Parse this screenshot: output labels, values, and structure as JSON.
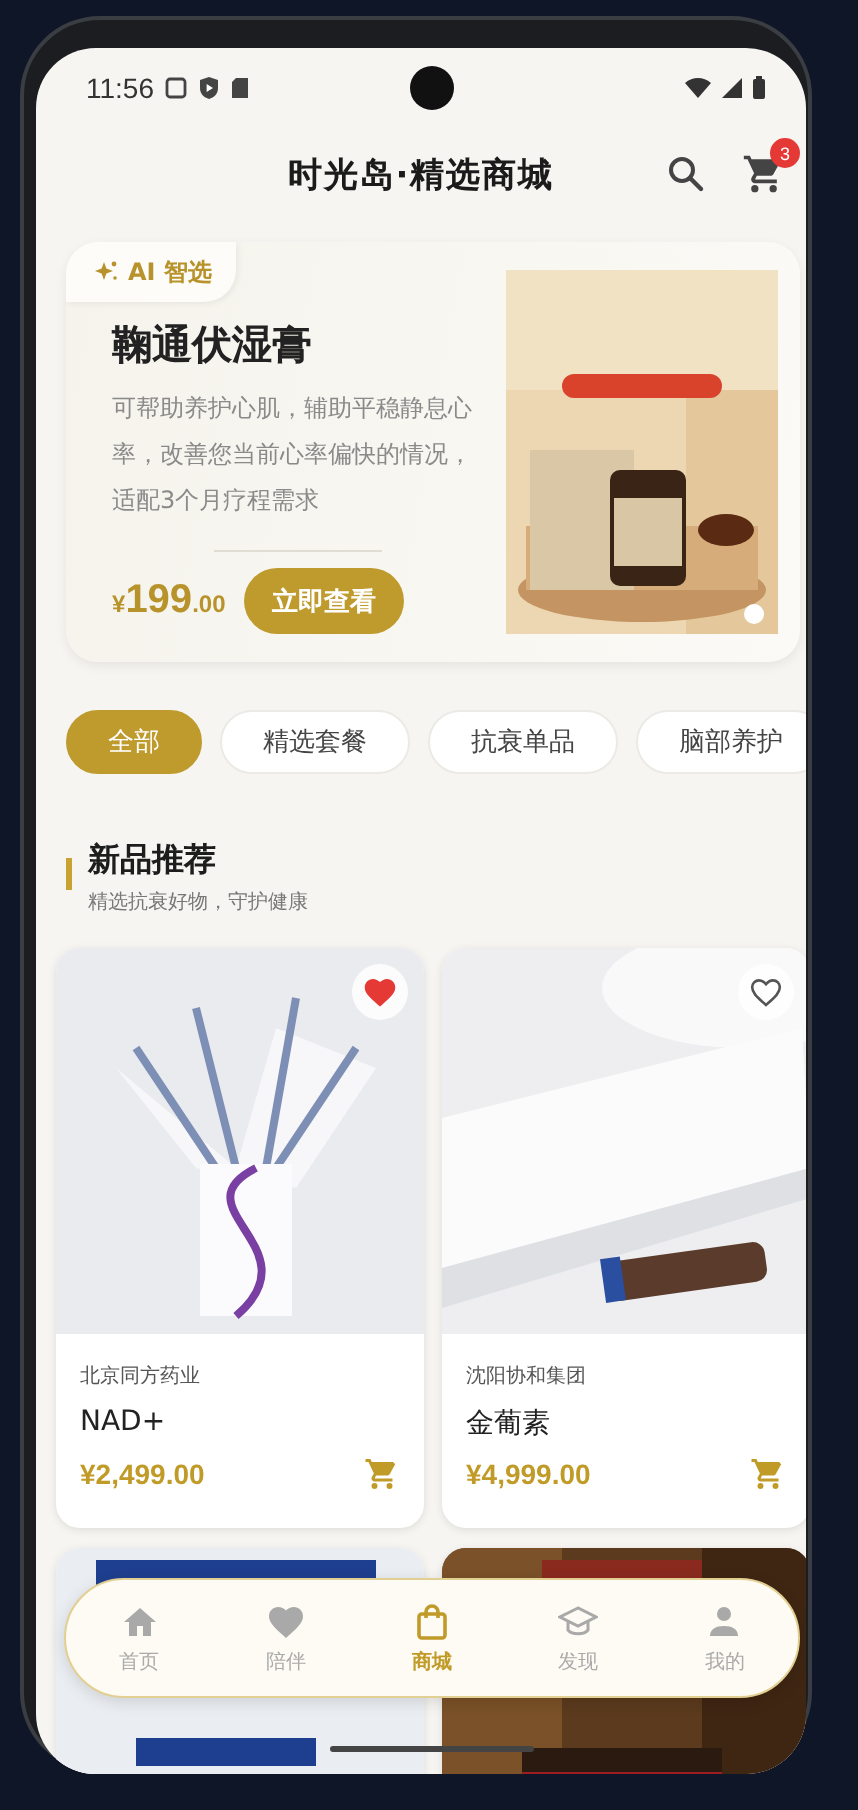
{
  "status_bar": {
    "time": "11:56"
  },
  "header": {
    "title": "时光岛·精选商城",
    "cart_count": "3"
  },
  "banner": {
    "tag": "AI 智选",
    "title": "鞠通伏湿膏",
    "description": "可帮助养护心肌，辅助平稳静息心率，改善您当前心率偏快的情况，适配3个月疗程需求",
    "price": {
      "currency": "¥",
      "amount": "199",
      "decimals": ".00"
    },
    "button": "立即查看",
    "image": {
      "kind": "picture"
    }
  },
  "categories": [
    {
      "label": "全部",
      "selected": true
    },
    {
      "label": "精选套餐",
      "selected": false
    },
    {
      "label": "抗衰单品",
      "selected": false
    },
    {
      "label": "脑部养护",
      "selected": false
    }
  ],
  "section": {
    "title": "新品推荐",
    "subtitle": "精选抗衰好物，守护健康"
  },
  "products": [
    {
      "kind": "full",
      "favorite": true,
      "brand": "北京同方药业",
      "name": "NAD+",
      "price": "¥2,499.00"
    },
    {
      "kind": "full",
      "favorite": false,
      "brand": "沈阳协和集团",
      "name": "金葡素",
      "price": "¥4,999.00"
    },
    {
      "kind": "picture"
    },
    {
      "kind": "picture"
    }
  ],
  "bottom_nav": [
    {
      "label": "首页",
      "selected": false
    },
    {
      "label": "陪伴",
      "selected": false
    },
    {
      "label": "商城",
      "selected": true
    },
    {
      "label": "发现",
      "selected": false
    },
    {
      "label": "我的",
      "selected": false
    }
  ]
}
